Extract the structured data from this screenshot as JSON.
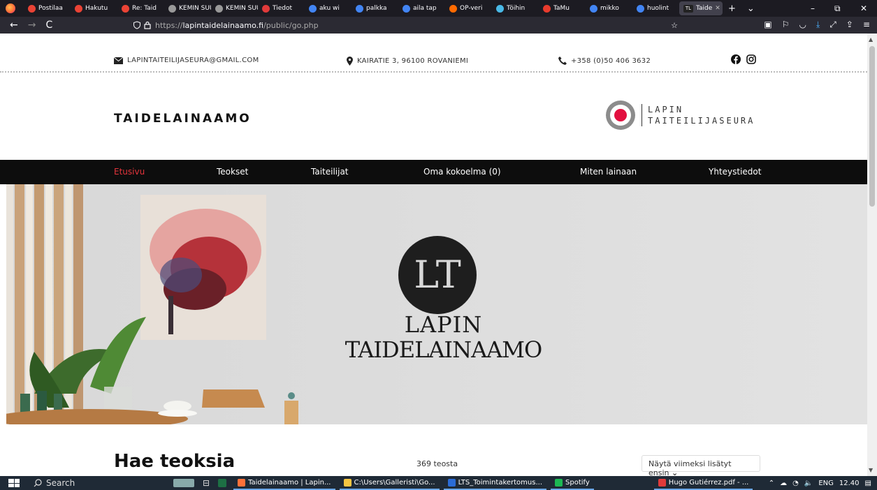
{
  "browser": {
    "tabs": [
      {
        "label": "Postilaa",
        "color": "#ea4335"
      },
      {
        "label": "Hakutu",
        "color": "#ea4335"
      },
      {
        "label": "Re: Taid",
        "color": "#ea4335"
      },
      {
        "label": "KEMIN SUU",
        "color": "#999999"
      },
      {
        "label": "KEMIN SUU",
        "color": "#999999"
      },
      {
        "label": "Tiedot",
        "color": "#e03a3a"
      },
      {
        "label": "aku wi",
        "color": "#4285f4"
      },
      {
        "label": "palkka",
        "color": "#4285f4"
      },
      {
        "label": "aila tap",
        "color": "#4285f4"
      },
      {
        "label": "OP-veri",
        "color": "#ff6a00"
      },
      {
        "label": "Töihin",
        "color": "#49b9e6"
      },
      {
        "label": "TaMu",
        "color": "#e83b2d"
      },
      {
        "label": "mikko",
        "color": "#4285f4"
      },
      {
        "label": "huolint",
        "color": "#4285f4"
      },
      {
        "label": "Taide",
        "color": "#ffffff",
        "active": true,
        "badge": "TL"
      }
    ],
    "new_tab": "+",
    "tab_list": "⌄",
    "minimize": "–",
    "restore": "⧉",
    "close": "✕",
    "back": "←",
    "forward": "→",
    "reload": "C",
    "url_prefix": "https://",
    "url_domain": "lapintaidelainaamo.fi",
    "url_path": "/public/go.php"
  },
  "topbar": {
    "email": "LAPINTAITEILIJASEURA@GMAIL.COM",
    "address": "KAIRATIE 3, 96100 ROVANIEMI",
    "phone": "+358 (0)50 406 3632"
  },
  "header": {
    "brand": "TAIDELAINAAMO",
    "logo_line1": "LAPIN",
    "logo_line2": "TAITEILIJASEURA"
  },
  "nav": {
    "items": [
      "Etusivu",
      "Teokset",
      "Taiteilijat",
      "Oma kokoelma (0)",
      "Miten lainaan",
      "Yhteystiedot"
    ],
    "active_color": "#e4343b"
  },
  "hero": {
    "monogram": "LT",
    "line1": "LAPIN",
    "line2": "TAIDELAINAAMO"
  },
  "search": {
    "title": "Hae teoksia",
    "count": "369 teosta",
    "sort": "Näytä viimeksi lisätyt ensin"
  },
  "taskbar": {
    "search": "Search",
    "apps": [
      "Taidelainaamo | Lapin...",
      "C:\\Users\\Galleristi\\Go...",
      "LTS_Toimintakertomus...",
      "Spotify",
      "Hugo Gutiérrez.pdf - ..."
    ],
    "lang": "ENG",
    "time": "12.40"
  }
}
